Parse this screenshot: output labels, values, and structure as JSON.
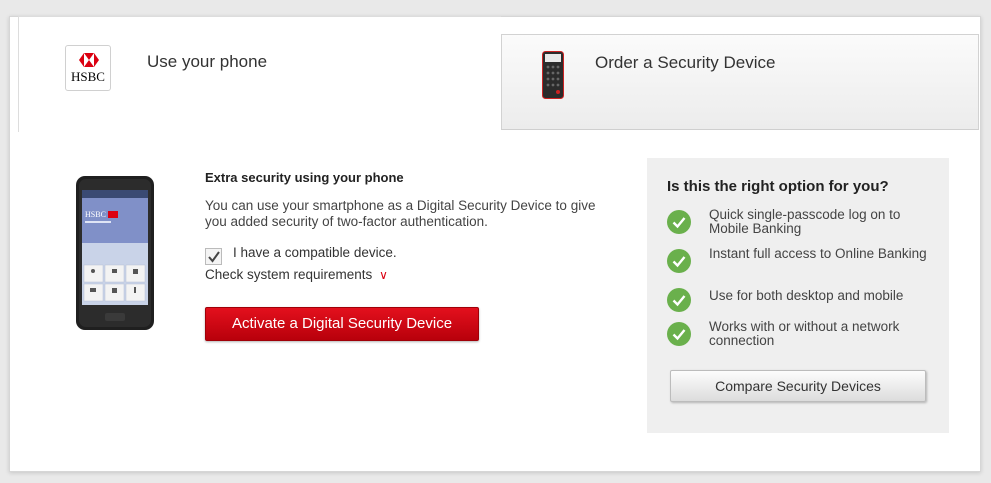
{
  "tabs": [
    {
      "label": "Use your phone",
      "logo_text": "HSBC",
      "active": true
    },
    {
      "label": "Order a Security Device",
      "active": false
    }
  ],
  "main": {
    "heading": "Extra security using your phone",
    "description": "You can use your smartphone as a Digital Security Device to give you added security of two-factor authentication.",
    "checkbox_label": "I have a compatible device.",
    "checkbox_checked": true,
    "system_requirements_link": "Check system requirements",
    "activate_button": "Activate a Digital Security Device"
  },
  "panel": {
    "title": "Is this the right option for you?",
    "benefits": [
      "Quick single-passcode log on to Mobile Banking",
      "Instant full access to Online Banking",
      "Use for both desktop and mobile",
      "Works with or without a network connection"
    ],
    "compare_button": "Compare Security Devices"
  },
  "colors": {
    "brand_red": "#db0011",
    "tick_green": "#6ab04c",
    "panel_bg": "#efefef"
  },
  "icons": {
    "logo": "hsbc-logo-icon",
    "device": "security-device-icon",
    "phone": "smartphone-illustration",
    "tick": "check-circle-icon",
    "expand": "double-chevron-down-icon"
  }
}
